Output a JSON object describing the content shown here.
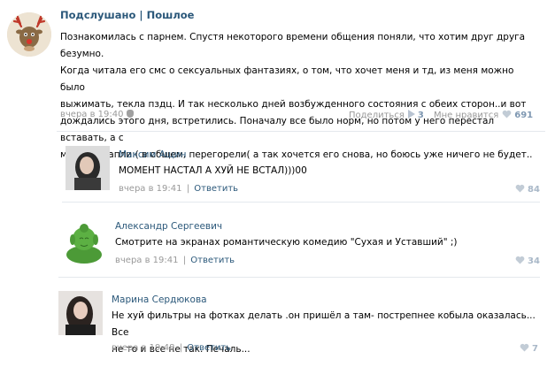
{
  "post": {
    "group_name": "Подслушано | Пошлое",
    "text_lines": [
      "Познакомилась с парнем. Спустя некоторого времени общения поняли, что хотим друг друга безумно.",
      "Когда читала его смс о сексуальных фантазиях, о том, что хочет меня и тд, из меня можно было",
      "выжимать, текла пздц. И так несколько дней возбужденного состояния с обеих сторон..и вот",
      "дождались этого дня, встретились. Поначалу все было норм, но потом у него перестал вставать, а с",
      "меня ни капли:( в общем, перегорели( а так хочется его снова, но боюсь уже ничего не будет.."
    ],
    "time": "вчера в 19:40",
    "share_label": "Поделиться",
    "share_count": "3",
    "like_label": "Мне нравится",
    "like_count": "691"
  },
  "comments": [
    {
      "author": "Максим Ащин",
      "text_lines": [
        "МОМЕНТ НАСТАЛ А ХУЙ НЕ ВСТАЛ)))00"
      ],
      "time": "вчера в 19:41",
      "reply_label": "Ответить",
      "likes": "84"
    },
    {
      "author": "Александр Сергеевич",
      "text_lines": [
        "Смотрите на экранах романтическую комедию \"Сухая и Уставший\" ;)"
      ],
      "time": "вчера в 19:41",
      "reply_label": "Ответить",
      "likes": "34"
    },
    {
      "author": "Марина Сердюкова",
      "text_lines": [
        "Не хуй фильтры на фотках делать .он пришёл а там- пострепнее кобыла оказалась... Все",
        "не то и все не так. Печаль..."
      ],
      "time": "вчера в 19:48",
      "reply_label": "Ответить",
      "likes": "7"
    }
  ],
  "colors": {
    "link": "#2b587a",
    "meta": "#999999",
    "count": "#7f98b2",
    "heart": "#c2ccd6"
  }
}
